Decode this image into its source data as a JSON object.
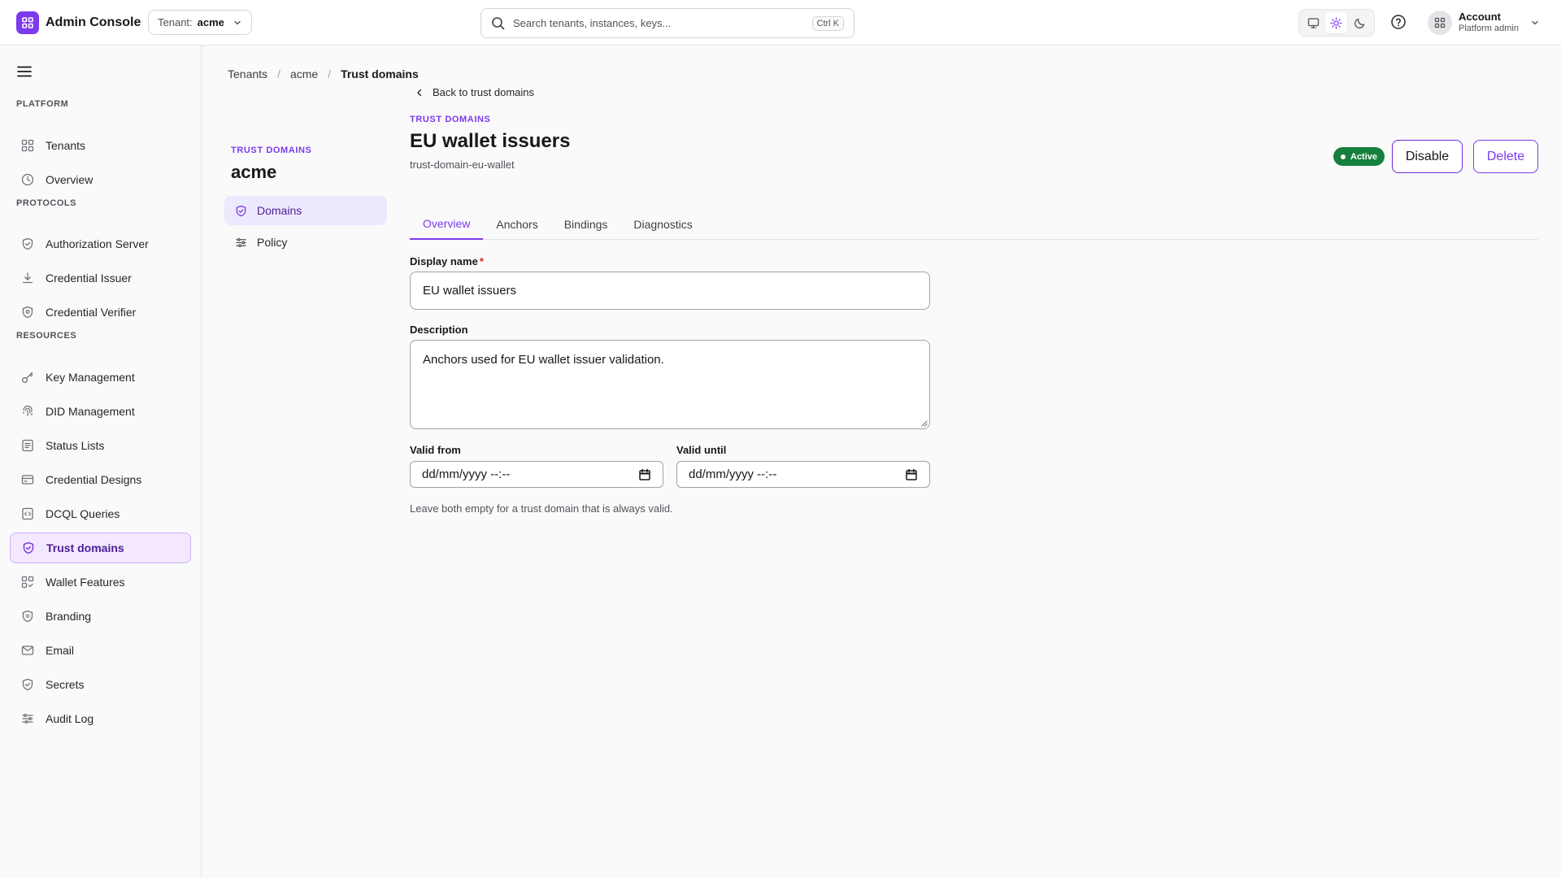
{
  "header": {
    "app_name": "Admin Console",
    "tenant_label": "Tenant:",
    "tenant_value": "acme",
    "search_placeholder": "Search tenants, instances, keys...",
    "search_shortcut": "Ctrl K",
    "theme_active": "light",
    "account_name": "Account",
    "account_role": "Platform admin"
  },
  "sidebar": {
    "sections": [
      {
        "label": "PLATFORM",
        "items": [
          {
            "label": "Tenants",
            "icon": "grid-icon"
          },
          {
            "label": "Overview",
            "icon": "clock-icon"
          }
        ]
      },
      {
        "label": "PROTOCOLS",
        "items": [
          {
            "label": "Authorization Server",
            "icon": "shield-check-icon"
          },
          {
            "label": "Credential Issuer",
            "icon": "download-icon"
          },
          {
            "label": "Credential Verifier",
            "icon": "shield-check-icon"
          }
        ]
      },
      {
        "label": "RESOURCES",
        "items": [
          {
            "label": "Key Management",
            "icon": "key-icon"
          },
          {
            "label": "DID Management",
            "icon": "fingerprint-icon"
          },
          {
            "label": "Status Lists",
            "icon": "list-icon"
          },
          {
            "label": "Credential Designs",
            "icon": "card-icon"
          },
          {
            "label": "DCQL Queries",
            "icon": "code-file-icon"
          },
          {
            "label": "Trust domains",
            "icon": "shield-check-icon",
            "active": true
          },
          {
            "label": "Wallet Features",
            "icon": "grid-check-icon"
          },
          {
            "label": "Branding",
            "icon": "badge-icon"
          },
          {
            "label": "Email",
            "icon": "mail-icon"
          },
          {
            "label": "Secrets",
            "icon": "shield-check-icon"
          },
          {
            "label": "Audit Log",
            "icon": "sliders-icon"
          }
        ]
      }
    ]
  },
  "subnav": {
    "eyebrow": "TRUST DOMAINS",
    "title": "acme",
    "items": [
      {
        "label": "Domains",
        "icon": "shield-check-icon",
        "active": true
      },
      {
        "label": "Policy",
        "icon": "sliders-icon"
      }
    ]
  },
  "breadcrumb": [
    "Tenants",
    "acme",
    "Trust domains"
  ],
  "main": {
    "back_label": "Back to trust domains",
    "eyebrow": "TRUST DOMAINS",
    "title": "EU wallet issuers",
    "subtitle": "trust-domain-eu-wallet",
    "status": "Active",
    "status_color": "#15803d",
    "disable_label": "Disable",
    "delete_label": "Delete",
    "tabs": [
      "Overview",
      "Anchors",
      "Bindings",
      "Diagnostics"
    ],
    "active_tab": "Overview",
    "form": {
      "display_name_label": "Display name",
      "required_mark": "*",
      "display_name_value": "EU wallet issuers",
      "description_label": "Description",
      "description_value": "Anchors used for EU wallet issuer validation.",
      "valid_from_label": "Valid from",
      "valid_from_value": "dd/mm/yyyy --:--",
      "valid_until_label": "Valid until",
      "valid_until_value": "dd/mm/yyyy --:--",
      "help_text": "Leave both empty for a trust domain that is always valid."
    }
  },
  "colors": {
    "accent": "#7c3aed",
    "active_bg": "#f3e8ff",
    "success": "#15803d"
  }
}
